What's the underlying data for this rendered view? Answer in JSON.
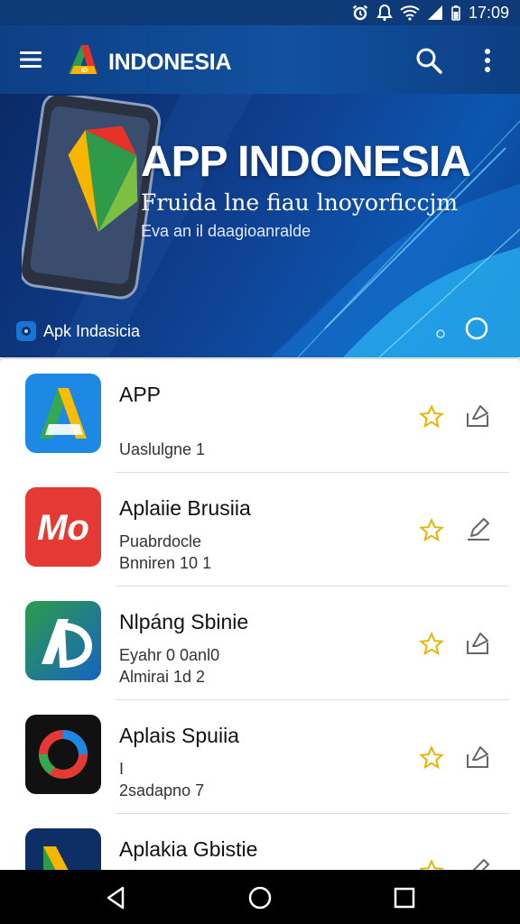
{
  "status_bar": {
    "time": "17:09",
    "icons": [
      "alarm-icon",
      "do-not-disturb-icon",
      "wifi-icon",
      "signal-icon",
      "battery-icon"
    ]
  },
  "app_bar": {
    "title": "INDONESIA",
    "icons": [
      "menu-icon",
      "app-logo",
      "search-icon",
      "more-vert-icon"
    ]
  },
  "banner": {
    "title": "APP INDONESIA",
    "subtitle": "Fruida lne fiau lnoyorficcjm",
    "tagline": "Eva an il daagioanralde",
    "brand_label": "Apk Indasicia",
    "colors": {
      "bg_dark": "#0a2a66",
      "bg_light": "#0c56b0",
      "accent": "#29b6f6"
    }
  },
  "apps": [
    {
      "name": "APP",
      "line1": "",
      "line2": "Uaslulgne 1",
      "icon": "app-a-icon"
    },
    {
      "name": "Aplaiie Brusiia",
      "line1": "Puabrdocle",
      "line2": "Bnniren 10 1",
      "icon": "app-mo-icon"
    },
    {
      "name": "Nlpáng Sbinie",
      "line1": "Eyahr 0 0anl0",
      "line2": "Almirai 1d 2",
      "icon": "app-ad-icon"
    },
    {
      "name": "Aplais Spuiia",
      "line1": "I",
      "line2": "2sadapno 7",
      "icon": "app-ring-icon"
    },
    {
      "name": "Aplakia Gbistie",
      "line1": "",
      "line2": "",
      "icon": "app-n-icon"
    }
  ],
  "colors": {
    "star": "#e3b600",
    "primary": "#11519f"
  }
}
